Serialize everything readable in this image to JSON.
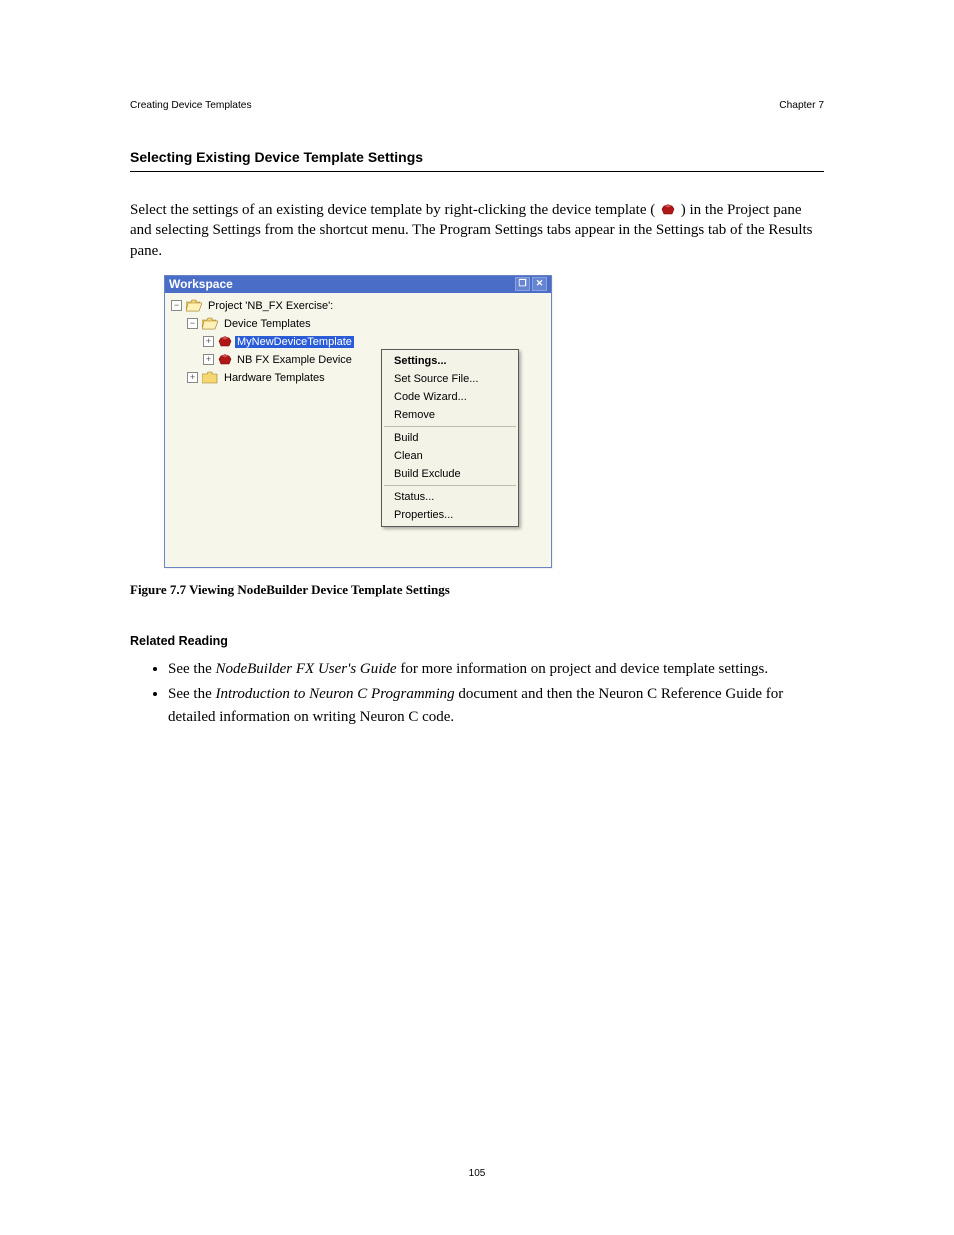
{
  "header": {
    "left": "Creating Device Templates",
    "right": "Chapter 7"
  },
  "section": {
    "title": "Selecting Existing Device Template Settings"
  },
  "body": {
    "paragraphs": [
      "Select the settings of an existing device template by right-clicking the device template (",
      ") in the Project pane and selecting Settings from the shortcut menu.  The Program Settings tabs appear in the Settings tab of the Results pane."
    ]
  },
  "figure": {
    "caption": "Figure 7.7  Viewing NodeBuilder Device Template Settings"
  },
  "related": {
    "title": "Related Reading",
    "items": [
      {
        "pre": "See the ",
        "em": "NodeBuilder FX User's Guide",
        "post": " for more information on project and device template settings."
      },
      {
        "pre": "See the ",
        "em": "Introduction to Neuron C Programming",
        "post": " document and then the Neuron C Reference Guide for detailed information on writing Neuron C code."
      }
    ]
  },
  "workspace": {
    "title": "Workspace",
    "tree": {
      "project": "Project 'NB_FX Exercise':",
      "device_templates": "Device Templates",
      "mynew": "MyNewDeviceTemplate",
      "example": "NB FX Example Device",
      "hardware": "Hardware Templates"
    },
    "context_menu": {
      "settings": "Settings...",
      "set_source": "Set Source File...",
      "code_wizard": "Code Wizard...",
      "remove": "Remove",
      "build": "Build",
      "clean": "Clean",
      "build_exclude": "Build Exclude",
      "status": "Status...",
      "properties": "Properties..."
    }
  },
  "footer": {
    "page": "105"
  }
}
